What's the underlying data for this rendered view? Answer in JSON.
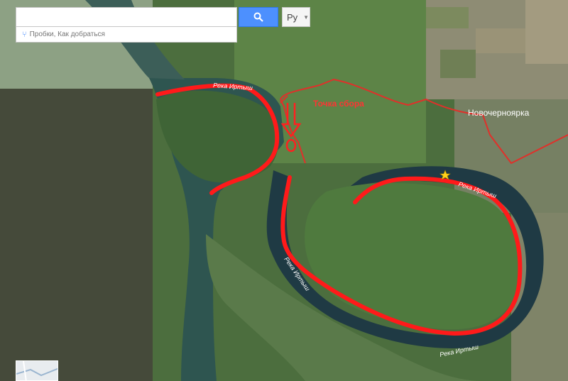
{
  "search": {
    "value": "",
    "placeholder": ""
  },
  "language_button": {
    "label": "Ру"
  },
  "suggestion": {
    "label": "Пробки, Как добраться"
  },
  "annotation": {
    "label": "Точка сбора",
    "color": "#ff2020"
  },
  "map_labels": {
    "river_top": "Река Иртыш",
    "river_right": "Река Иртыш",
    "river_middle": "Река Иртыш",
    "river_bottom": "Река Иртыш",
    "town": "Новочерноярка"
  },
  "colors": {
    "route": "#ff1a1a",
    "road": "#e0302a",
    "water": "#21404a",
    "marker": "#ffd21a"
  }
}
